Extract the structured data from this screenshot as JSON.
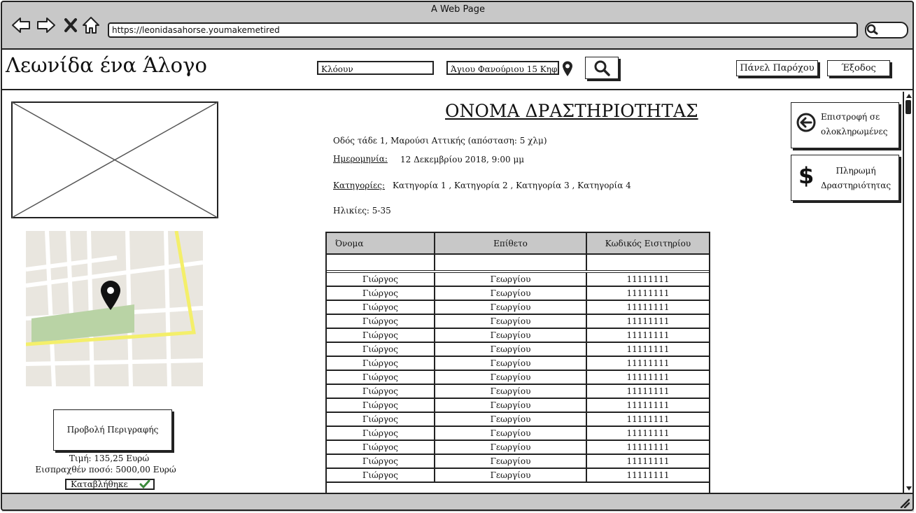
{
  "window": {
    "title": "A Web Page",
    "url": "https://leonidasahorse.youmakemetired"
  },
  "header": {
    "logo": "Λεωνίδα ένα Άλογο",
    "search_what": "Κλόουν",
    "search_where": "Άγιου Φανούριου 15 Κηφισιά",
    "provider_panel": "Πάνελ Παρόχου",
    "logout": "Έξοδος"
  },
  "activity": {
    "title": "ΟΝΟΜΑ ΔΡΑΣΤΗΡΙΟΤΗΤΑΣ",
    "address": "Οδός τάδε 1, Μαρούσι Αττικής (απόσταση: 5 χλμ)",
    "date_label": "Ημερομηνία:",
    "date_value": "12 Δεκεμβρίου 2018, 9:00 μμ",
    "categories_label": "Κατηγορίες:",
    "categories_value": "Κατηγορία 1 , Κατηγορία 2 , Κατηγορία 3 , Κατηγορία 4",
    "ages": "Ηλικίες: 5-35"
  },
  "left": {
    "description_button": "Προβολή Περιγραφής",
    "price": "Τιμή: 135,25 Ευρώ",
    "collected": "Εισπραχθέν ποσό: 5000,00 Ευρώ",
    "paid": "Καταβλήθηκε"
  },
  "actions": {
    "back": [
      "Επιστροφή σε",
      "ολοκληρωμένες"
    ],
    "payment": [
      "Πληρωμή",
      "Δραστηριότητας"
    ]
  },
  "table": {
    "headers": [
      "Όνομα",
      "Επίθετο",
      "Κωδικός Εισιτηρίου"
    ],
    "rows": [
      [
        "Γιώργος",
        "Γεωργίου",
        "11111111"
      ],
      [
        "Γιώργος",
        "Γεωργίου",
        "11111111"
      ],
      [
        "Γιώργος",
        "Γεωργίου",
        "11111111"
      ],
      [
        "Γιώργος",
        "Γεωργίου",
        "11111111"
      ],
      [
        "Γιώργος",
        "Γεωργίου",
        "11111111"
      ],
      [
        "Γιώργος",
        "Γεωργίου",
        "11111111"
      ],
      [
        "Γιώργος",
        "Γεωργίου",
        "11111111"
      ],
      [
        "Γιώργος",
        "Γεωργίου",
        "11111111"
      ],
      [
        "Γιώργος",
        "Γεωργίου",
        "11111111"
      ],
      [
        "Γιώργος",
        "Γεωργίου",
        "11111111"
      ],
      [
        "Γιώργος",
        "Γεωργίου",
        "11111111"
      ],
      [
        "Γιώργος",
        "Γεωργίου",
        "11111111"
      ],
      [
        "Γιώργος",
        "Γεωργίου",
        "11111111"
      ],
      [
        "Γιώργος",
        "Γεωργίου",
        "11111111"
      ],
      [
        "Γιώργος",
        "Γεωργίου",
        "11111111"
      ]
    ]
  },
  "colors": {
    "chrome": "#c8c8c8",
    "ink": "#222222",
    "map_park": "#b9d3a5",
    "map_road": "#f4ef6a",
    "check": "#3a8a3a"
  }
}
